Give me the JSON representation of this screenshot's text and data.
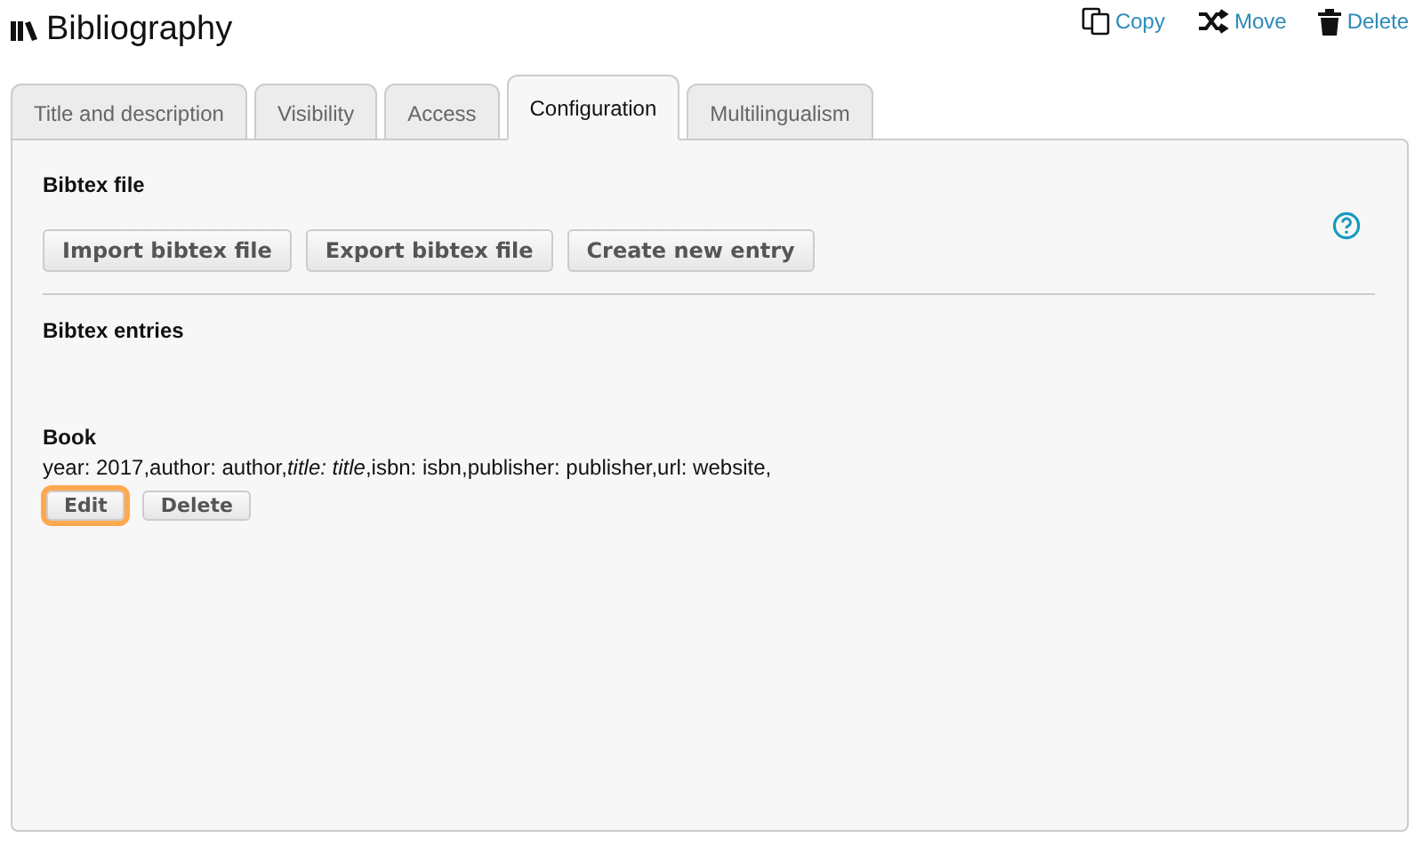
{
  "page": {
    "title": "Bibliography"
  },
  "actions": [
    {
      "kind": "copy",
      "label": "Copy"
    },
    {
      "kind": "move",
      "label": "Move"
    },
    {
      "kind": "delete",
      "label": "Delete"
    }
  ],
  "tabs": [
    {
      "label": "Title and description",
      "selected": false
    },
    {
      "label": "Visibility",
      "selected": false
    },
    {
      "label": "Access",
      "selected": false
    },
    {
      "label": "Configuration",
      "selected": true
    },
    {
      "label": "Multilingualism",
      "selected": false
    }
  ],
  "file_section": {
    "heading": "Bibtex file",
    "buttons": [
      "Import bibtex file",
      "Export bibtex file",
      "Create new entry"
    ]
  },
  "entries_section": {
    "heading": "Bibtex entries"
  },
  "entries": [
    {
      "type": "Book",
      "details": "year: 2017,author: author,*title: title*,isbn: isbn,publisher: publisher,url: website,",
      "buttons": [
        {
          "label": "Edit",
          "highlighted": true
        },
        {
          "label": "Delete",
          "highlighted": false
        }
      ]
    }
  ]
}
